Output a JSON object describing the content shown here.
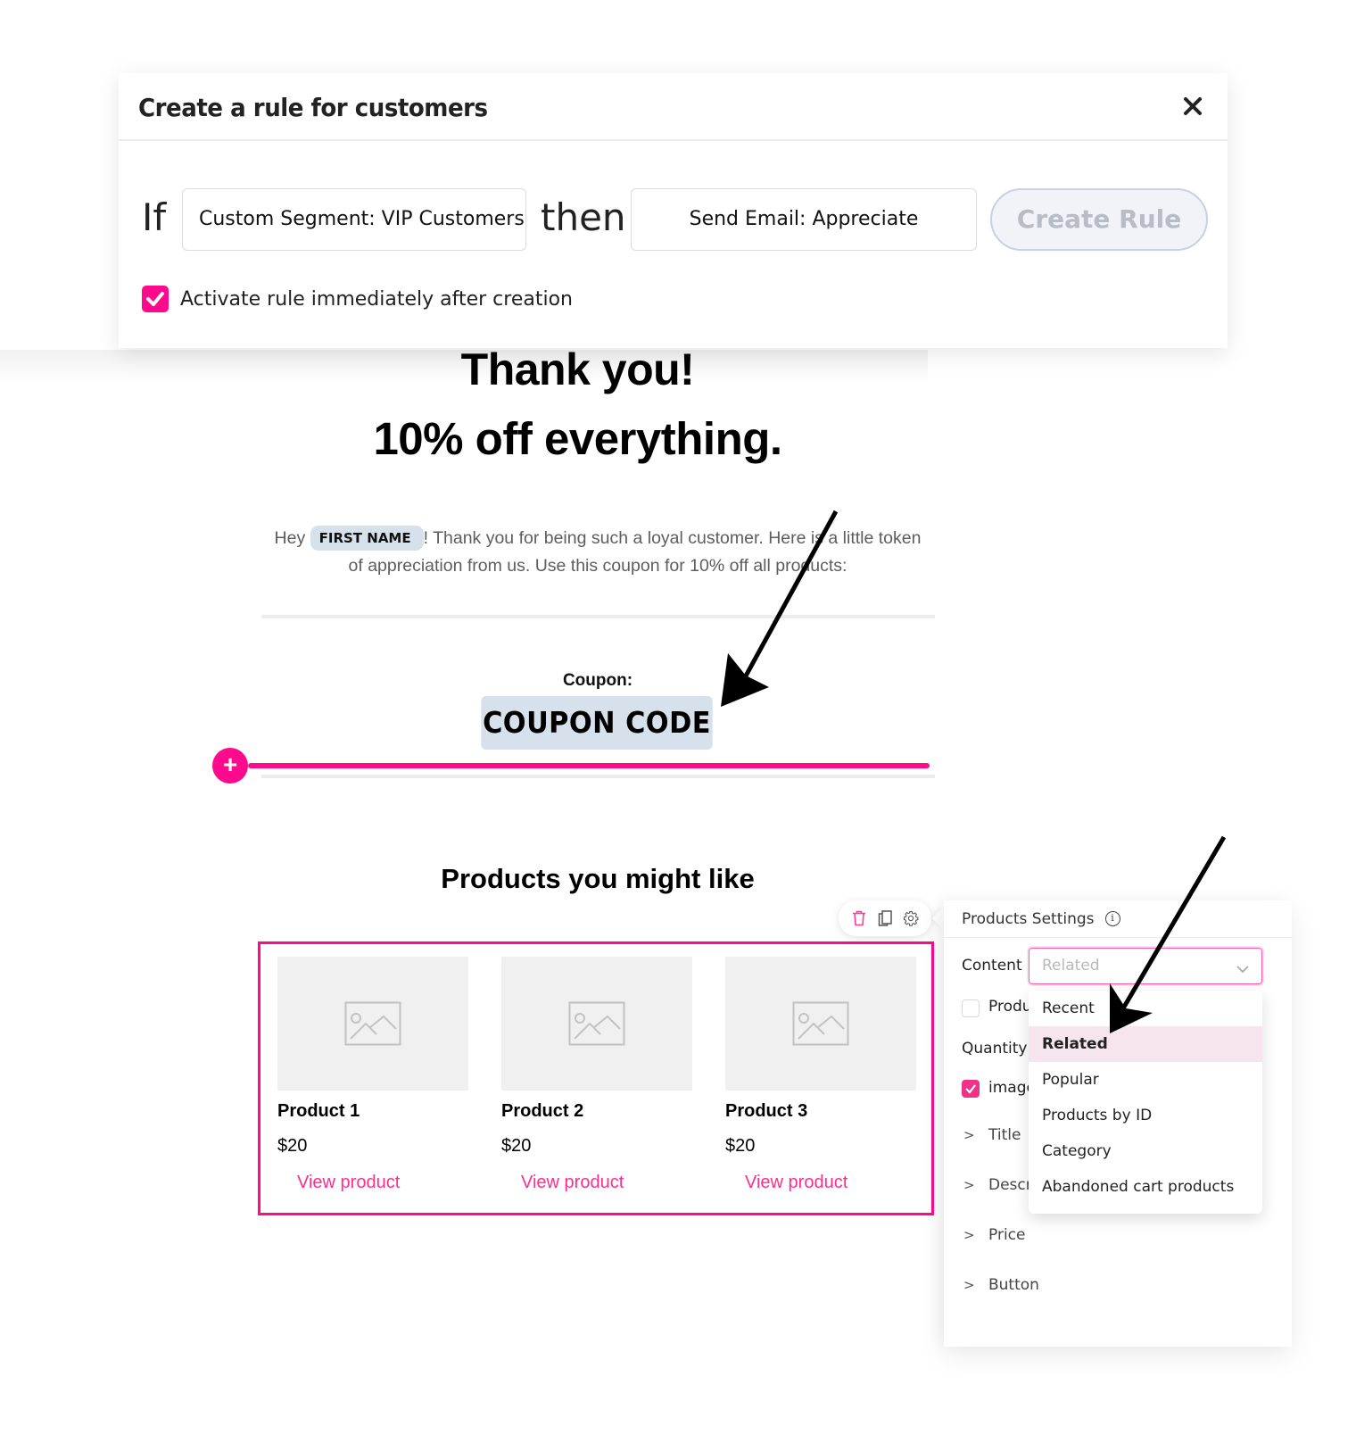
{
  "modal": {
    "title": "Create a rule for customers",
    "if_label": "If",
    "then_label": "then",
    "condition_value": "Custom Segment: VIP Customers",
    "action_value": "Send Email: Appreciate",
    "create_button": "Create Rule",
    "activate_label": "Activate rule immediately after creation",
    "activate_checked": true,
    "close_icon": "close-icon"
  },
  "email": {
    "headline_1": "Thank you!",
    "headline_2": "10% off everything.",
    "body_prefix": "Hey",
    "merge_tag": "FIRST NAME",
    "body_suffix": "! Thank you for being such a loyal customer. Here is a little token of appreciation from us. Use this coupon for 10% off all products:",
    "coupon_label": "Coupon:",
    "coupon_code": "COUPON CODE",
    "insert_button": "+",
    "products_title": "Products you might like",
    "products": [
      {
        "name": "Product 1",
        "price": "$20",
        "link": "View product"
      },
      {
        "name": "Product 2",
        "price": "$20",
        "link": "View product"
      },
      {
        "name": "Product 3",
        "price": "$20",
        "link": "View product"
      }
    ]
  },
  "toolbar": {
    "icons": [
      "trash-icon",
      "duplicate-icon",
      "gear-icon"
    ]
  },
  "settings": {
    "title": "Products Settings",
    "content_label": "Content",
    "content_value": "Related",
    "product_checkbox_label": "Produ",
    "quantity_label": "Quantity",
    "image_checkbox_label": "image",
    "image_checked": true,
    "product_checked": false,
    "sections": [
      "Title",
      "Descr",
      "Price",
      "Button"
    ]
  },
  "dropdown": {
    "options": [
      "Recent",
      "Related",
      "Popular",
      "Products by ID",
      "Category",
      "Abandoned cart products"
    ],
    "selected": "Related"
  },
  "colors": {
    "accent": "#ff0a8c",
    "merge_tag_bg": "#d6e1ec",
    "selected_option_bg": "#f6e4ee"
  }
}
